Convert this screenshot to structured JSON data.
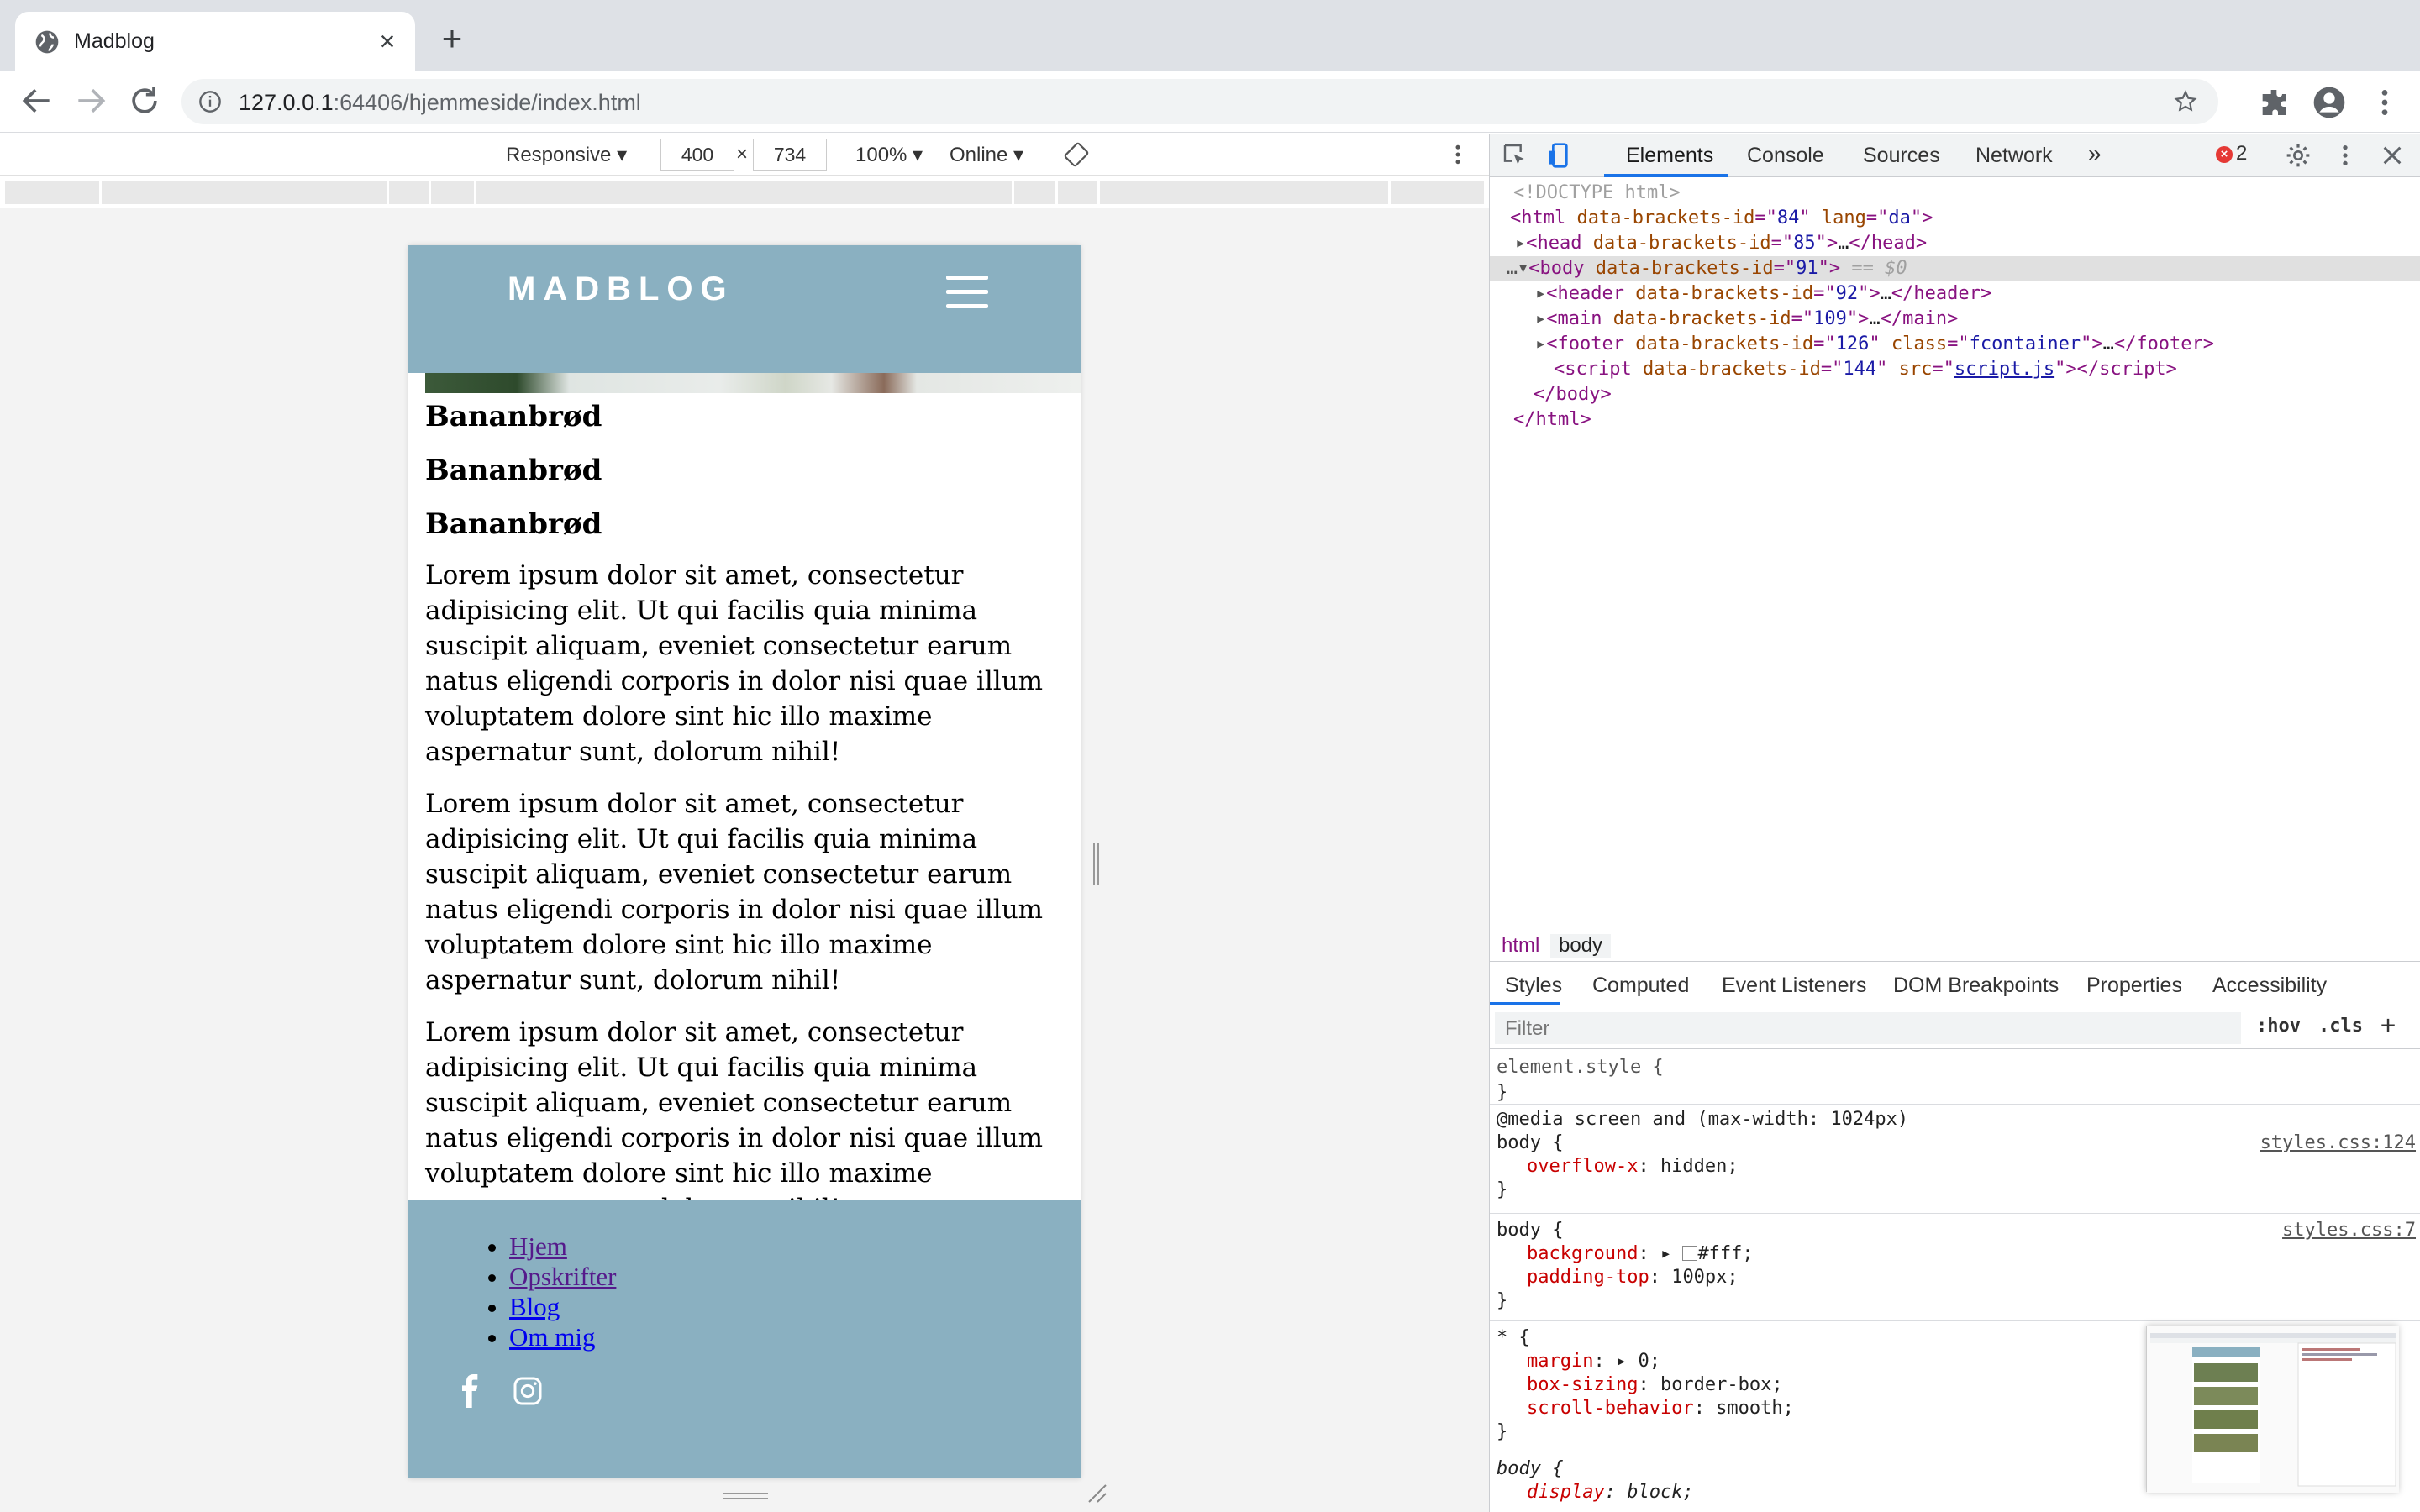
{
  "browser": {
    "tab_title": "Madblog",
    "url_host": "127.0.0.1",
    "url_rest": ":64406/hjemmeside/index.html"
  },
  "device_toolbar": {
    "mode": "Responsive",
    "width": "400",
    "height": "734",
    "times": "×",
    "zoom": "100%",
    "network": "Online"
  },
  "page": {
    "logo": "MADBLOG",
    "headings": [
      "Bananbrød",
      "Bananbrød",
      "Bananbrød"
    ],
    "paragraph": "Lorem ipsum dolor sit amet, consectetur adipisicing elit. Ut qui facilis quia minima suscipit aliquam, eveniet consectetur earum natus eligendi corporis in dolor nisi quae illum voluptatem dolore sint hic illo maxime aspernatur sunt, dolorum nihil!",
    "footer_links": [
      "Hjem",
      "Opskrifter",
      "Blog",
      "Om mig"
    ]
  },
  "devtools": {
    "tabs": [
      "Elements",
      "Console",
      "Sources",
      "Network"
    ],
    "more": "»",
    "error_count": "2",
    "dom": {
      "doctype": "<!DOCTYPE html>",
      "html_open": [
        "<html",
        " data-brackets-id",
        "=\"",
        "84",
        "\"",
        " lang",
        "=\"",
        "da",
        "\">"
      ],
      "line_head": "head",
      "head_id": "85",
      "line_body": "body",
      "body_id": "91",
      "body_suffix": " == $0",
      "header_id": "92",
      "main_id": "109",
      "footer_id": "126",
      "footer_class": "fcontainer",
      "script_id": "144",
      "script_src": "script.js",
      "body_close": "</body>",
      "html_close": "</html>"
    },
    "breadcrumbs": [
      "html",
      "body"
    ],
    "subtabs": [
      "Styles",
      "Computed",
      "Event Listeners",
      "DOM Breakpoints",
      "Properties",
      "Accessibility"
    ],
    "filter_placeholder": "Filter",
    "hov": ":hov",
    "cls": ".cls",
    "plus": "+",
    "styles": {
      "element_style": "element.style {",
      "media": "@media screen and (max-width: 1024px)",
      "rule1_sel": "body {",
      "rule1_src": "styles.css:124",
      "rule1_prop": "overflow-x",
      "rule1_val": ": hidden;",
      "rule2_sel": "body {",
      "rule2_src": "styles.css:7",
      "rule2_p1": "background",
      "rule2_v1": "#fff;",
      "rule2_p2": "padding-top",
      "rule2_v2": ": 100px;",
      "rule3_sel": "* {",
      "rule3_p1": "margin",
      "rule3_v1": "0;",
      "rule3_p2": "box-sizing",
      "rule3_v2": ": border-box;",
      "rule3_p3": "scroll-behavior",
      "rule3_v3": ": smooth;",
      "rule4_sel": "body {",
      "rule4_p1": "display",
      "rule4_v1": ": block;",
      "close": "}"
    }
  },
  "colors": {
    "site_blue": "#8ab0c1",
    "active_tab": "#1a73e8",
    "error": "#e53935"
  }
}
